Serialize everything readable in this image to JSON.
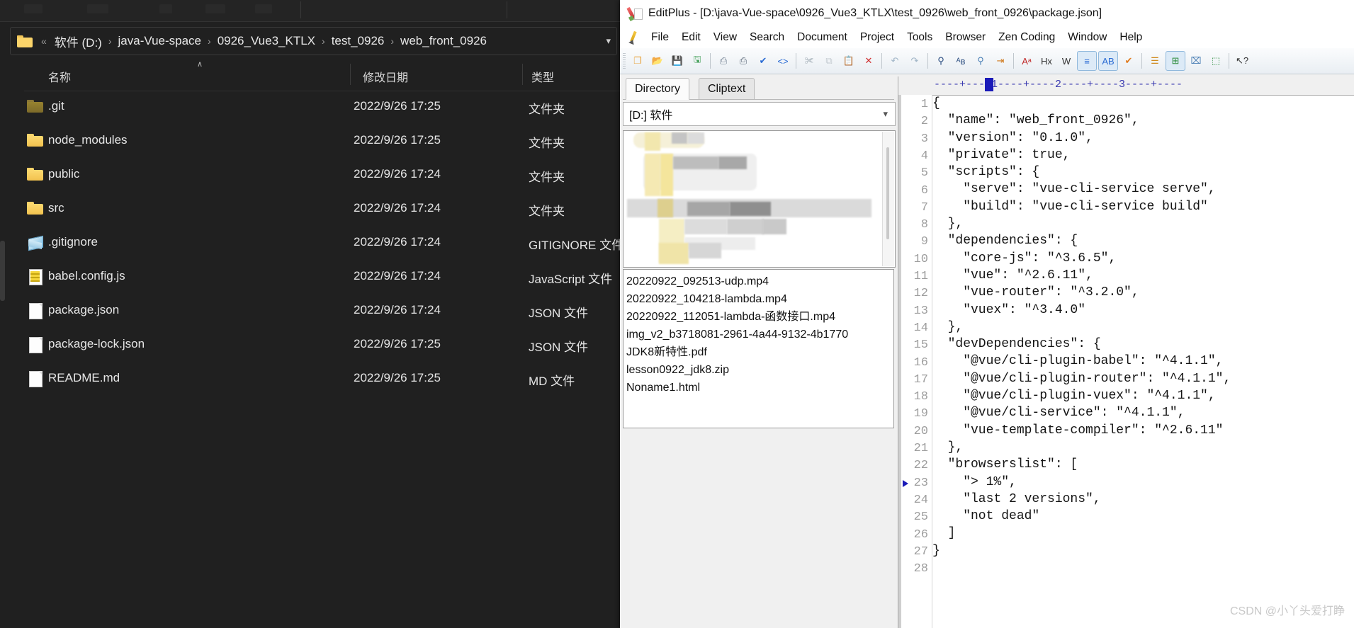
{
  "explorer": {
    "address": {
      "folder_icon": "folder-icon",
      "overflow_chevron": "«",
      "crumbs": [
        "软件 (D:)",
        "java-Vue-space",
        "0926_Vue3_KTLX",
        "test_0926",
        "web_front_0926"
      ],
      "separator": "›",
      "dropdown_icon": "chevron-down-icon"
    },
    "columns": {
      "name": "名称",
      "date": "修改日期",
      "type": "类型",
      "sort_caret": "∧"
    },
    "rows": [
      {
        "icon": "folder-dim-icon",
        "name": ".git",
        "date": "2022/9/26 17:25",
        "type": "文件夹"
      },
      {
        "icon": "folder-icon",
        "name": "node_modules",
        "date": "2022/9/26 17:25",
        "type": "文件夹"
      },
      {
        "icon": "folder-icon",
        "name": "public",
        "date": "2022/9/26 17:24",
        "type": "文件夹"
      },
      {
        "icon": "folder-icon",
        "name": "src",
        "date": "2022/9/26 17:24",
        "type": "文件夹"
      },
      {
        "icon": "gitignore-icon",
        "name": ".gitignore",
        "date": "2022/9/26 17:24",
        "type": "GITIGNORE 文件"
      },
      {
        "icon": "javascript-icon",
        "name": "babel.config.js",
        "date": "2022/9/26 17:24",
        "type": "JavaScript 文件"
      },
      {
        "icon": "document-icon",
        "name": "package.json",
        "date": "2022/9/26 17:24",
        "type": "JSON 文件"
      },
      {
        "icon": "document-icon",
        "name": "package-lock.json",
        "date": "2022/9/26 17:25",
        "type": "JSON 文件"
      },
      {
        "icon": "document-icon",
        "name": "README.md",
        "date": "2022/9/26 17:25",
        "type": "MD 文件"
      }
    ]
  },
  "editplus": {
    "app_icon": "editplus-logo-icon",
    "title": "EditPlus - [D:\\java-Vue-space\\0926_Vue3_KTLX\\test_0926\\web_front_0926\\package.json]",
    "menu_icon": "pencil-icon",
    "menu": [
      "File",
      "Edit",
      "View",
      "Search",
      "Document",
      "Project",
      "Tools",
      "Browser",
      "Zen Coding",
      "Window",
      "Help"
    ],
    "toolbar": [
      {
        "name": "new-file-icon",
        "glyph": "❐",
        "color": "#e8a33d",
        "sep": false,
        "active": false
      },
      {
        "name": "open-file-icon",
        "glyph": "📂",
        "color": "#e3a72c",
        "sep": false,
        "active": false
      },
      {
        "name": "save-icon",
        "glyph": "💾",
        "color": "#3f9d54",
        "sep": false,
        "active": false
      },
      {
        "name": "save-all-icon",
        "glyph": "🖫",
        "color": "#3f9d54",
        "sep": true,
        "active": false
      },
      {
        "name": "print-preview-icon",
        "glyph": "⎙",
        "color": "#6b7b8c",
        "sep": false,
        "active": false
      },
      {
        "name": "print-icon",
        "glyph": "⎙",
        "color": "#4a5a6b",
        "sep": false,
        "active": false
      },
      {
        "name": "spellcheck-icon",
        "glyph": "✔",
        "color": "#2b6cd4",
        "sep": false,
        "active": false
      },
      {
        "name": "view-in-browser-icon",
        "glyph": "<>",
        "color": "#2b6cd4",
        "sep": true,
        "active": false
      },
      {
        "name": "cut-icon",
        "glyph": "✀",
        "color": "#b9c2c9",
        "sep": false,
        "active": false
      },
      {
        "name": "copy-icon",
        "glyph": "⧉",
        "color": "#c2c9cf",
        "sep": false,
        "active": false
      },
      {
        "name": "paste-icon",
        "glyph": "📋",
        "color": "#c08a3e",
        "sep": false,
        "active": false
      },
      {
        "name": "delete-icon",
        "glyph": "✕",
        "color": "#cf2d2d",
        "sep": true,
        "active": false
      },
      {
        "name": "undo-icon",
        "glyph": "↶",
        "color": "#9fb4c6",
        "sep": false,
        "active": false
      },
      {
        "name": "redo-icon",
        "glyph": "↷",
        "color": "#9fb4c6",
        "sep": true,
        "active": false
      },
      {
        "name": "find-icon",
        "glyph": "⚲",
        "color": "#2b4d80",
        "sep": false,
        "active": false
      },
      {
        "name": "replace-icon",
        "glyph": "ᴬʙ",
        "color": "#2b4d80",
        "sep": false,
        "active": false
      },
      {
        "name": "find-in-files-icon",
        "glyph": "⚲",
        "color": "#4a7fb5",
        "sep": false,
        "active": false
      },
      {
        "name": "goto-line-icon",
        "glyph": "⇥",
        "color": "#d07a1e",
        "sep": true,
        "active": false
      },
      {
        "name": "change-case-icon",
        "glyph": "Aᵃ",
        "color": "#c02a2a",
        "sep": false,
        "active": false
      },
      {
        "name": "hex-view-icon",
        "glyph": "Hx",
        "color": "#333333",
        "sep": false,
        "active": false
      },
      {
        "name": "word-wrap-icon",
        "glyph": "W",
        "color": "#333333",
        "sep": false,
        "active": false
      },
      {
        "name": "indent-icon",
        "glyph": "≡",
        "color": "#2b6cd4",
        "sep": false,
        "active": true
      },
      {
        "name": "sort-lines-icon",
        "glyph": "AB",
        "color": "#2b6cd4",
        "sep": false,
        "active": true
      },
      {
        "name": "check-icon",
        "glyph": "✔",
        "color": "#e07b1e",
        "sep": true,
        "active": false
      },
      {
        "name": "document-list-icon",
        "glyph": "☰",
        "color": "#d08a1e",
        "sep": false,
        "active": false
      },
      {
        "name": "directory-window-icon",
        "glyph": "⊞",
        "color": "#2b8c3c",
        "sep": false,
        "active": true
      },
      {
        "name": "output-window-icon",
        "glyph": "⌧",
        "color": "#4a7fb5",
        "sep": false,
        "active": false
      },
      {
        "name": "fullscreen-icon",
        "glyph": "⬚",
        "color": "#2b8c3c",
        "sep": true,
        "active": false
      },
      {
        "name": "context-help-icon",
        "glyph": "↖?",
        "color": "#333333",
        "sep": false,
        "active": false
      }
    ],
    "directory_panel": {
      "tabs": [
        {
          "label": "Directory",
          "selected": true
        },
        {
          "label": "Cliptext",
          "selected": false
        }
      ],
      "drive_selector": {
        "value": "[D:] 软件",
        "caret_icon": "chevron-down-icon"
      },
      "tree_note": "blurred-directory-tree",
      "files": [
        "20220922_092513-udp.mp4",
        "20220922_104218-lambda.mp4",
        "20220922_112051-lambda-函数接口.mp4",
        "img_v2_b3718081-2961-4a44-9132-4b1770",
        "JDK8新特性.pdf",
        "lesson0922_jdk8.zip",
        "Noname1.html"
      ]
    },
    "editor": {
      "ruler": "----+----1----+----2----+----3----+----",
      "bookmark_line": 23,
      "lines": [
        {
          "n": 1,
          "text": "{"
        },
        {
          "n": 2,
          "text": "  \"name\": \"web_front_0926\","
        },
        {
          "n": 3,
          "text": "  \"version\": \"0.1.0\","
        },
        {
          "n": 4,
          "text": "  \"private\": true,"
        },
        {
          "n": 5,
          "text": "  \"scripts\": {"
        },
        {
          "n": 6,
          "text": "    \"serve\": \"vue-cli-service serve\","
        },
        {
          "n": 7,
          "text": "    \"build\": \"vue-cli-service build\""
        },
        {
          "n": 8,
          "text": "  },"
        },
        {
          "n": 9,
          "text": "  \"dependencies\": {"
        },
        {
          "n": 10,
          "text": "    \"core-js\": \"^3.6.5\","
        },
        {
          "n": 11,
          "text": "    \"vue\": \"^2.6.11\","
        },
        {
          "n": 12,
          "text": "    \"vue-router\": \"^3.2.0\","
        },
        {
          "n": 13,
          "text": "    \"vuex\": \"^3.4.0\""
        },
        {
          "n": 14,
          "text": "  },"
        },
        {
          "n": 15,
          "text": "  \"devDependencies\": {"
        },
        {
          "n": 16,
          "text": "    \"@vue/cli-plugin-babel\": \"^4.1.1\","
        },
        {
          "n": 17,
          "text": "    \"@vue/cli-plugin-router\": \"^4.1.1\","
        },
        {
          "n": 18,
          "text": "    \"@vue/cli-plugin-vuex\": \"^4.1.1\","
        },
        {
          "n": 19,
          "text": "    \"@vue/cli-service\": \"^4.1.1\","
        },
        {
          "n": 20,
          "text": "    \"vue-template-compiler\": \"^2.6.11\""
        },
        {
          "n": 21,
          "text": "  },"
        },
        {
          "n": 22,
          "text": "  \"browserslist\": ["
        },
        {
          "n": 23,
          "text": "    \"> 1%\","
        },
        {
          "n": 24,
          "text": "    \"last 2 versions\","
        },
        {
          "n": 25,
          "text": "    \"not dead\""
        },
        {
          "n": 26,
          "text": "  ]"
        },
        {
          "n": 27,
          "text": "}"
        },
        {
          "n": 28,
          "text": ""
        }
      ]
    }
  },
  "watermark": "CSDN @小丫头爱打睁"
}
